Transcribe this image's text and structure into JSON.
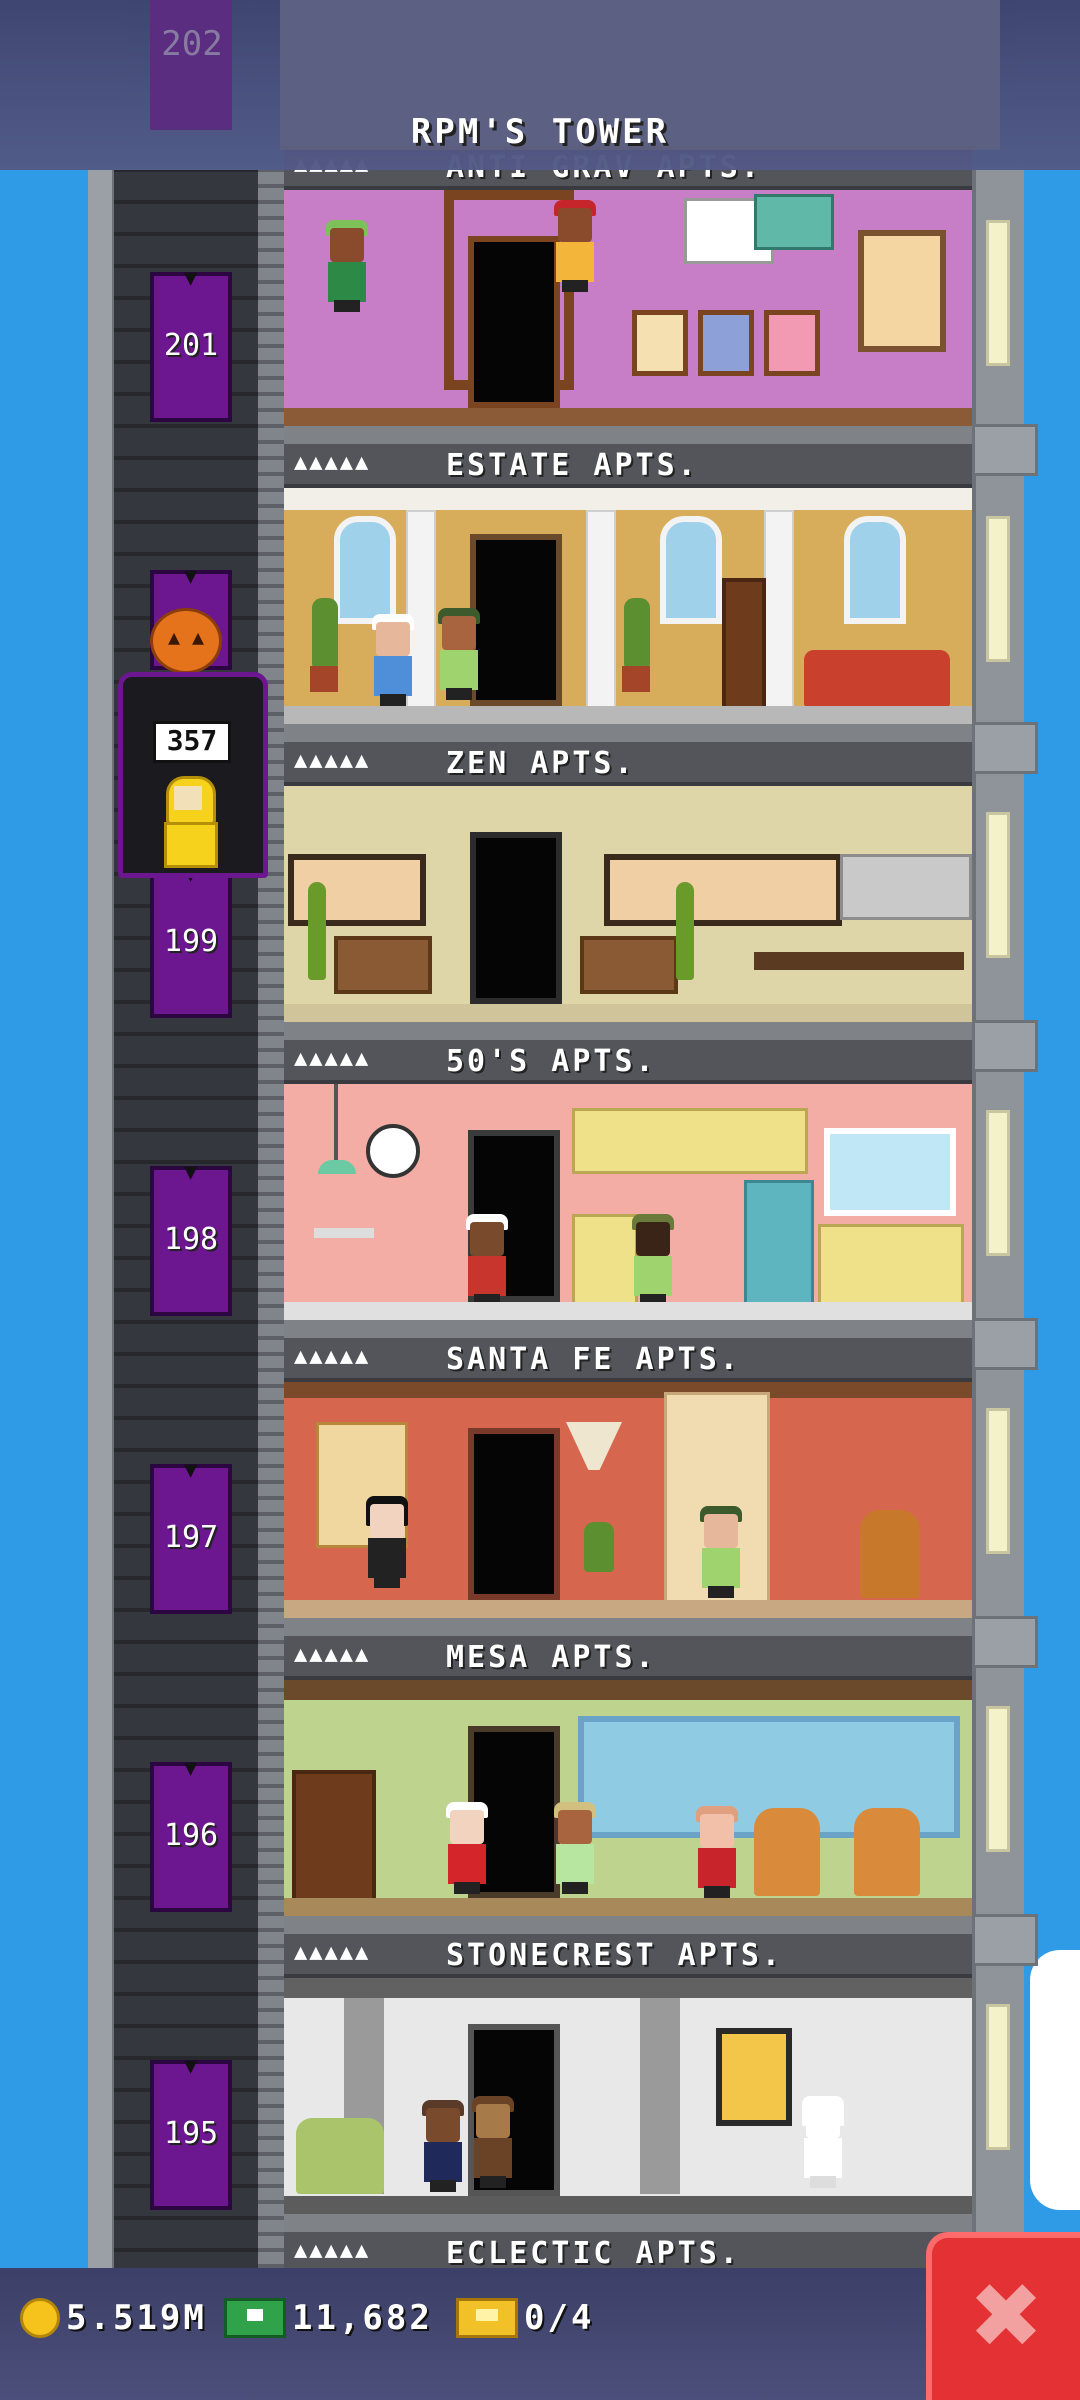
{
  "header": {
    "tower_name": "RPM'S TOWER",
    "ghost_floor_number": "202"
  },
  "floors": [
    {
      "name": "ANTI GRAV APTS.",
      "stars": "▲▲▲▲▲",
      "elevator_number": "201"
    },
    {
      "name": "ESTATE APTS.",
      "stars": "▲▲▲▲▲",
      "elevator_number": ""
    },
    {
      "name": "ZEN APTS.",
      "stars": "▲▲▲▲▲",
      "elevator_number": "199"
    },
    {
      "name": "50'S APTS.",
      "stars": "▲▲▲▲▲",
      "elevator_number": "198"
    },
    {
      "name": "SANTA FE APTS.",
      "stars": "▲▲▲▲▲",
      "elevator_number": "197"
    },
    {
      "name": "MESA APTS.",
      "stars": "▲▲▲▲▲",
      "elevator_number": "196"
    },
    {
      "name": "STONECREST APTS.",
      "stars": "▲▲▲▲▲",
      "elevator_number": "195"
    },
    {
      "name": "ECLECTIC APTS.",
      "stars": "▲▲▲▲▲",
      "elevator_number": ""
    }
  ],
  "elevator": {
    "passenger_count": "357",
    "decoration_icon": "pumpkin-icon"
  },
  "status_bar": {
    "coins": "5.519M",
    "bux": "11,682",
    "tickets": "0/4",
    "close_icon": "close-icon"
  },
  "colors": {
    "sky": "#2f9be6",
    "elevator": "#6c1690",
    "close_button": "#e33134",
    "coin": "#f6c21c",
    "bux": "#2fa24a"
  }
}
